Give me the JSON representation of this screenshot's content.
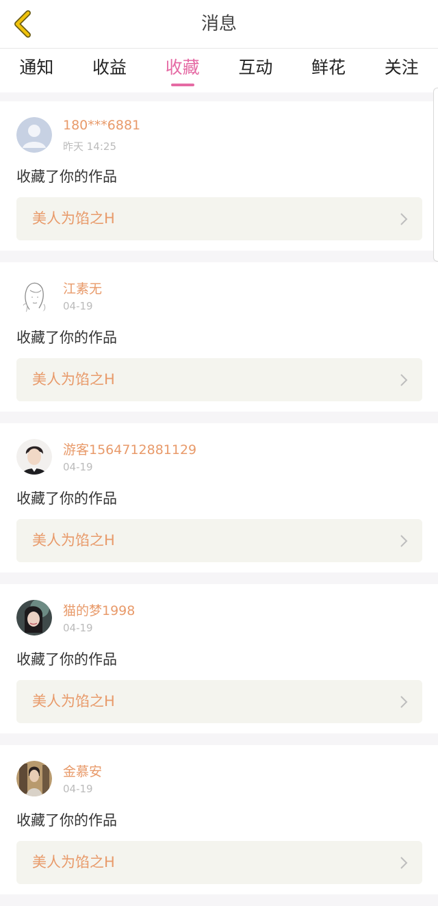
{
  "header": {
    "title": "消息",
    "back_icon": "chevron-left-icon",
    "accent": "#f0c20a"
  },
  "tabs": [
    {
      "label": "通知",
      "active": false
    },
    {
      "label": "收益",
      "active": false
    },
    {
      "label": "收藏",
      "active": true
    },
    {
      "label": "互动",
      "active": false
    },
    {
      "label": "鲜花",
      "active": false
    },
    {
      "label": "关注",
      "active": false
    }
  ],
  "colors": {
    "active_tab": "#e56aa4",
    "username": "#e89a6a",
    "work_bg": "#f4f4ee"
  },
  "messages": [
    {
      "username": "180***6881",
      "time": "昨天 14:25",
      "action": "收藏了你的作品",
      "work": "美人为馅之H",
      "avatar": "default-avatar"
    },
    {
      "username": "江素无",
      "time": "04-19",
      "action": "收藏了你的作品",
      "work": "美人为馅之H",
      "avatar": "sketch-avatar"
    },
    {
      "username": "游客1564712881129",
      "time": "04-19",
      "action": "收藏了你的作品",
      "work": "美人为馅之H",
      "avatar": "photo-avatar"
    },
    {
      "username": "猫的梦1998",
      "time": "04-19",
      "action": "收藏了你的作品",
      "work": "美人为馅之H",
      "avatar": "photo-avatar"
    },
    {
      "username": "金慕安",
      "time": "04-19",
      "action": "收藏了你的作品",
      "work": "美人为馅之H",
      "avatar": "photo-avatar"
    }
  ]
}
